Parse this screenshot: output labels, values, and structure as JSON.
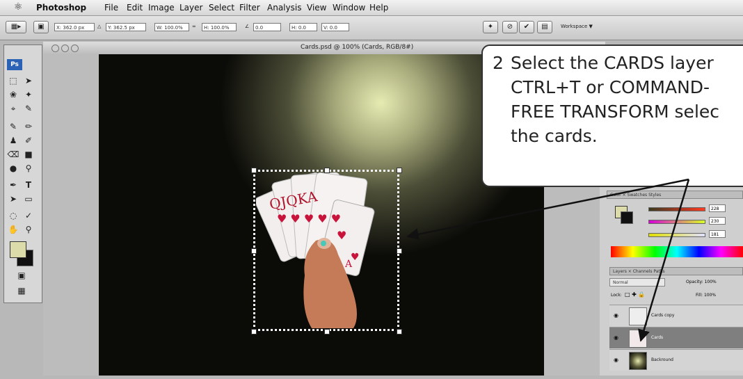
{
  "menubar": {
    "apple_glyph": "",
    "items": [
      "Photoshop",
      "File",
      "Edit",
      "Image",
      "Layer",
      "Select",
      "Filter",
      "Analysis",
      "View",
      "Window",
      "Help"
    ]
  },
  "options_bar": {
    "x_value": "X: 362.0 px",
    "y_value": "Y: 362.5 px",
    "w_value": "W: 100.0%",
    "h_value": "H: 100.0%",
    "angle_value": "0.0",
    "h_skew": "H: 0.0",
    "v_skew": "V: 0.0",
    "workspace_label": "Workspace ▼"
  },
  "document": {
    "title": "Cards.psd @ 100% (Cards, RGB/8#)"
  },
  "toolbox": {
    "logo": "Ps"
  },
  "panels": {
    "color_tabs": "Color × Swatches Styles",
    "r_value": "228",
    "g_value": "230",
    "b_value": "181",
    "layers_tabs": "Layers × Channels Paths",
    "blend_mode": "Normal",
    "opacity_label": "Opacity: 100%",
    "lock_label": "Lock:",
    "fill_label": "Fill: 100%",
    "layers": [
      {
        "name": "Cards copy"
      },
      {
        "name": "Cards"
      },
      {
        "name": "Backround"
      }
    ]
  },
  "callout": {
    "number": "2",
    "lines": [
      "Select the CARDS layer",
      "CTRL+T or COMMAND-",
      "FREE TRANSFORM selec",
      "the cards."
    ]
  },
  "colors": {
    "selected_layer": "#7f7f7f",
    "callout_border": "#333333"
  }
}
